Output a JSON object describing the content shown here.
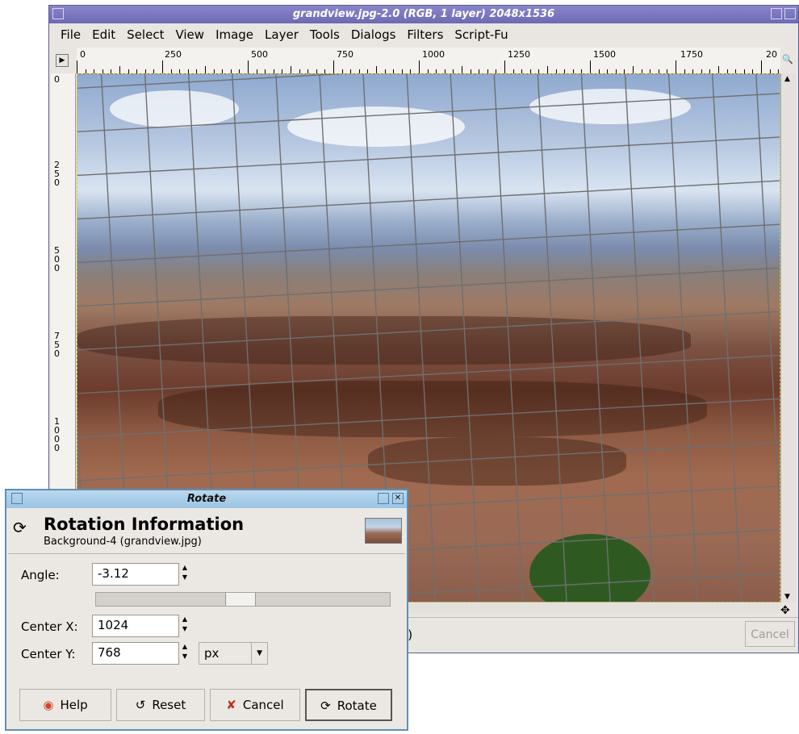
{
  "main_window": {
    "title": "grandview.jpg-2.0 (RGB, 1 layer) 2048x1536",
    "menu": [
      "File",
      "Edit",
      "Select",
      "View",
      "Image",
      "Layer",
      "Tools",
      "Dialogs",
      "Filters",
      "Script-Fu"
    ],
    "ruler_h_labels": [
      "0",
      "250",
      "500",
      "750",
      "1000",
      "1250",
      "1500",
      "1750",
      "20"
    ],
    "ruler_v_labels": [
      "0",
      "250",
      "500",
      "750",
      "1000"
    ],
    "status_text": "B)",
    "status_cancel_label": "Cancel"
  },
  "rotate_dialog": {
    "title": "Rotate",
    "heading": "Rotation Information",
    "subheading": "Background-4 (grandview.jpg)",
    "angle_label": "Angle:",
    "angle_value": "-3.12",
    "center_x_label": "Center X:",
    "center_x_value": "1024",
    "center_y_label": "Center Y:",
    "center_y_value": "768",
    "unit": "px",
    "buttons": {
      "help": "Help",
      "reset": "Reset",
      "cancel": "Cancel",
      "rotate": "Rotate"
    }
  },
  "colors": {
    "title_bar": "#6d69b5",
    "dialog_title_bar": "#9cc4e4",
    "selection_dash": "#d1c23a"
  }
}
